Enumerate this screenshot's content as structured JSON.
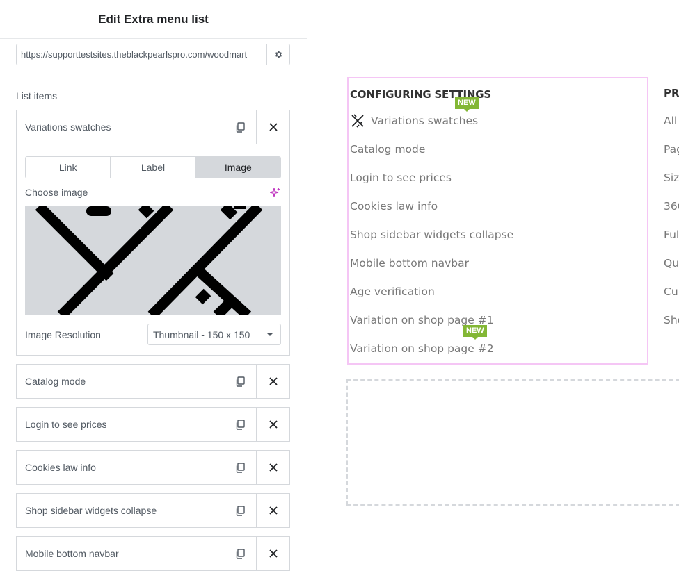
{
  "panel": {
    "title": "Edit Extra menu list",
    "url_value": "https://supporttestsites.theblackpearlspro.com/woodmart",
    "list_items_label": "List items",
    "expanded_item": {
      "title": "Variations swatches",
      "tabs": [
        "Link",
        "Label",
        "Image"
      ],
      "active_tab": "Image",
      "choose_image_label": "Choose image",
      "image_resolution_label": "Image Resolution",
      "image_resolution_value": "Thumbnail - 150 x 150"
    },
    "collapsed_items": [
      "Catalog mode",
      "Login to see prices",
      "Cookies law info",
      "Shop sidebar widgets collapse",
      "Mobile bottom navbar"
    ]
  },
  "preview": {
    "heading": "CONFIGURING SETTINGS",
    "items": [
      "Variations swatches",
      "Catalog mode",
      "Login to see prices",
      "Cookies law info",
      "Shop sidebar widgets collapse",
      "Mobile bottom navbar",
      "Age verification",
      "Variation on shop page #1",
      "Variation on shop page #2"
    ],
    "badge_text": "NEW",
    "col2_heading": "PR",
    "col2_items": [
      "All",
      "Pag",
      "Siz",
      "360",
      "Ful",
      "Qu",
      "Cu",
      "Sho"
    ]
  },
  "colors": {
    "badge": "#83b735",
    "highlight_border": "#f5c6f5",
    "ai_accent": "#c036c0"
  }
}
